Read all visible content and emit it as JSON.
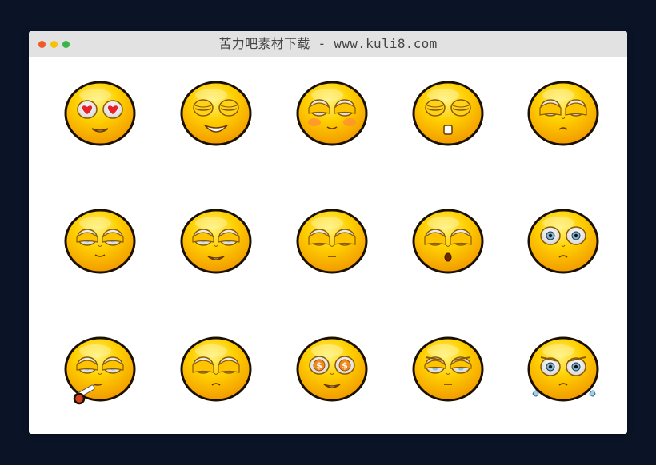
{
  "window": {
    "title": "苦力吧素材下载 - www.kuli8.com",
    "controls": [
      "close",
      "minimize",
      "maximize"
    ],
    "colors": {
      "background": "#0b1427",
      "titlebar": "#e2e2e2",
      "content": "#ffffff"
    }
  },
  "emoji_grid": {
    "rows": 3,
    "columns": 5,
    "face_color": "#ffc400",
    "items": [
      {
        "name": "heart-eyes-emoji-icon"
      },
      {
        "name": "happy-closed-eyes-emoji-icon"
      },
      {
        "name": "blushing-emoji-icon"
      },
      {
        "name": "surprised-closed-eyes-emoji-icon"
      },
      {
        "name": "unamused-emoji-icon"
      },
      {
        "name": "half-lidded-emoji-icon"
      },
      {
        "name": "smug-grin-emoji-icon"
      },
      {
        "name": "bored-emoji-icon"
      },
      {
        "name": "oh-bored-emoji-icon"
      },
      {
        "name": "wide-eyed-emoji-icon"
      },
      {
        "name": "smoking-emoji-icon"
      },
      {
        "name": "annoyed-emoji-icon"
      },
      {
        "name": "money-eyes-emoji-icon"
      },
      {
        "name": "worried-emoji-icon"
      },
      {
        "name": "sweating-emoji-icon"
      }
    ]
  }
}
